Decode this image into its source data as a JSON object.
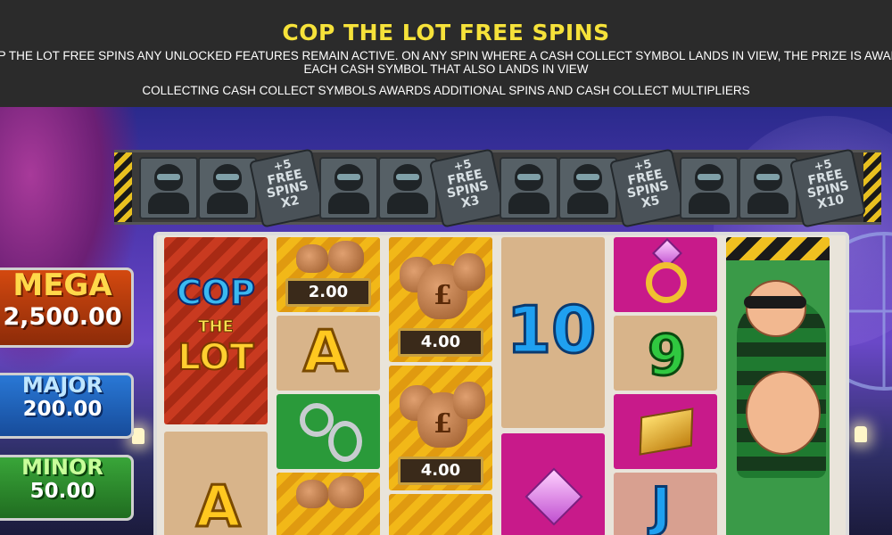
{
  "banner": {
    "title": "COP THE LOT FREE SPINS",
    "line1": "G COP THE LOT FREE SPINS ANY UNLOCKED FEATURES REMAIN ACTIVE. ON ANY SPIN WHERE A CASH COLLECT SYMBOL LANDS IN VIEW, THE PRIZE IS AWARDED",
    "line2": "EACH CASH SYMBOL THAT ALSO LANDS IN VIEW",
    "line3": "COLLECTING CASH COLLECT SYMBOLS AWARDS ADDITIONAL SPINS AND CASH COLLECT MULTIPLIERS"
  },
  "trail": {
    "tiles": [
      {
        "type": "robber"
      },
      {
        "type": "robber"
      },
      {
        "type": "free_spins",
        "plus": "+5",
        "free": "FREE",
        "spins": "SPINS",
        "mult": "X2"
      },
      {
        "type": "robber"
      },
      {
        "type": "robber"
      },
      {
        "type": "free_spins",
        "plus": "+5",
        "free": "FREE",
        "spins": "SPINS",
        "mult": "X3"
      },
      {
        "type": "robber"
      },
      {
        "type": "robber"
      },
      {
        "type": "free_spins",
        "plus": "+5",
        "free": "FREE",
        "spins": "SPINS",
        "mult": "X5"
      },
      {
        "type": "robber"
      },
      {
        "type": "robber"
      },
      {
        "type": "free_spins",
        "plus": "+5",
        "free": "FREE",
        "spins": "SPINS",
        "mult": "X10"
      }
    ]
  },
  "jackpots": {
    "mega": {
      "label": "MEGA",
      "value": "2,500.00"
    },
    "major": {
      "label": "MAJOR",
      "value": "200.00"
    },
    "minor": {
      "label": "MINOR",
      "value": "50.00"
    }
  },
  "reels": {
    "cop_logo": {
      "line1": "COP",
      "line2": "THE",
      "line3": "LOT"
    },
    "cash_values": [
      "2.00",
      "4.00",
      "4.00"
    ],
    "symbols": {
      "a": "A",
      "ten": "10",
      "nine": "9",
      "j": "J"
    }
  },
  "colors": {
    "banner_bg": "#2b2b2b",
    "title": "#f6e23a",
    "mega": "#d64a10",
    "major": "#2a7ad8",
    "minor": "#3aa83a"
  }
}
